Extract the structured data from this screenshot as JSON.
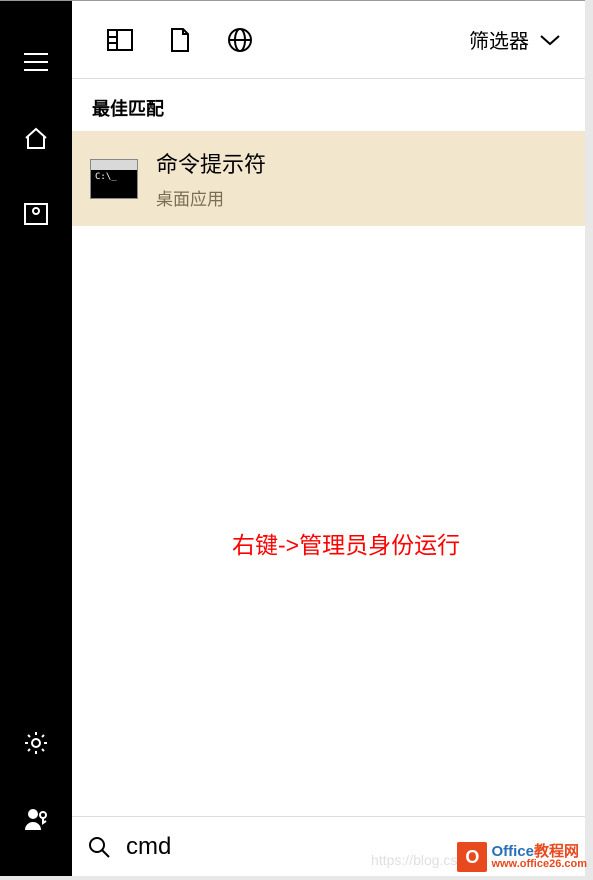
{
  "sidebar": {
    "icons": {
      "menu": "hamburger-icon",
      "home": "home-icon",
      "photo": "photo-icon",
      "settings": "gear-icon",
      "profile": "person-icon"
    }
  },
  "topbar": {
    "tab_news": "news-icon",
    "tab_doc": "document-icon",
    "tab_web": "globe-icon",
    "filter_label": "筛选器"
  },
  "results": {
    "section_label": "最佳匹配",
    "item": {
      "title": "命令提示符",
      "subtitle": "桌面应用"
    }
  },
  "annotation": "右键->管理员身份运行",
  "search": {
    "value": "cmd"
  },
  "watermarks": {
    "blog": "https://blog.csdn",
    "office_top_1": "Office",
    "office_top_2": "教程网",
    "office_bottom": "www.office26.com"
  }
}
